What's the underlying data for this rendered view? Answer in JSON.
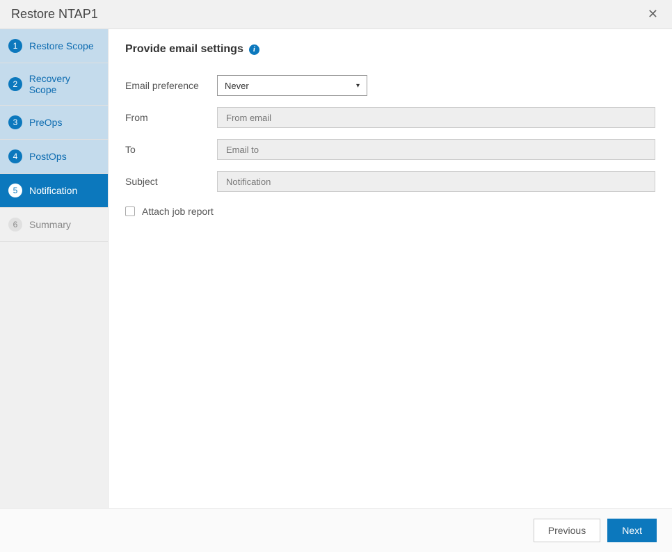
{
  "header": {
    "title": "Restore NTAP1"
  },
  "sidebar": {
    "steps": [
      {
        "num": "1",
        "label": "Restore Scope",
        "state": "completed"
      },
      {
        "num": "2",
        "label": "Recovery Scope",
        "state": "completed"
      },
      {
        "num": "3",
        "label": "PreOps",
        "state": "completed"
      },
      {
        "num": "4",
        "label": "PostOps",
        "state": "completed"
      },
      {
        "num": "5",
        "label": "Notification",
        "state": "active"
      },
      {
        "num": "6",
        "label": "Summary",
        "state": "pending"
      }
    ]
  },
  "main": {
    "title": "Provide email settings",
    "fields": {
      "email_preference": {
        "label": "Email preference",
        "value": "Never"
      },
      "from": {
        "label": "From",
        "placeholder": "From email"
      },
      "to": {
        "label": "To",
        "placeholder": "Email to"
      },
      "subject": {
        "label": "Subject",
        "placeholder": "Notification"
      }
    },
    "attach_label": "Attach job report"
  },
  "footer": {
    "previous": "Previous",
    "next": "Next"
  }
}
